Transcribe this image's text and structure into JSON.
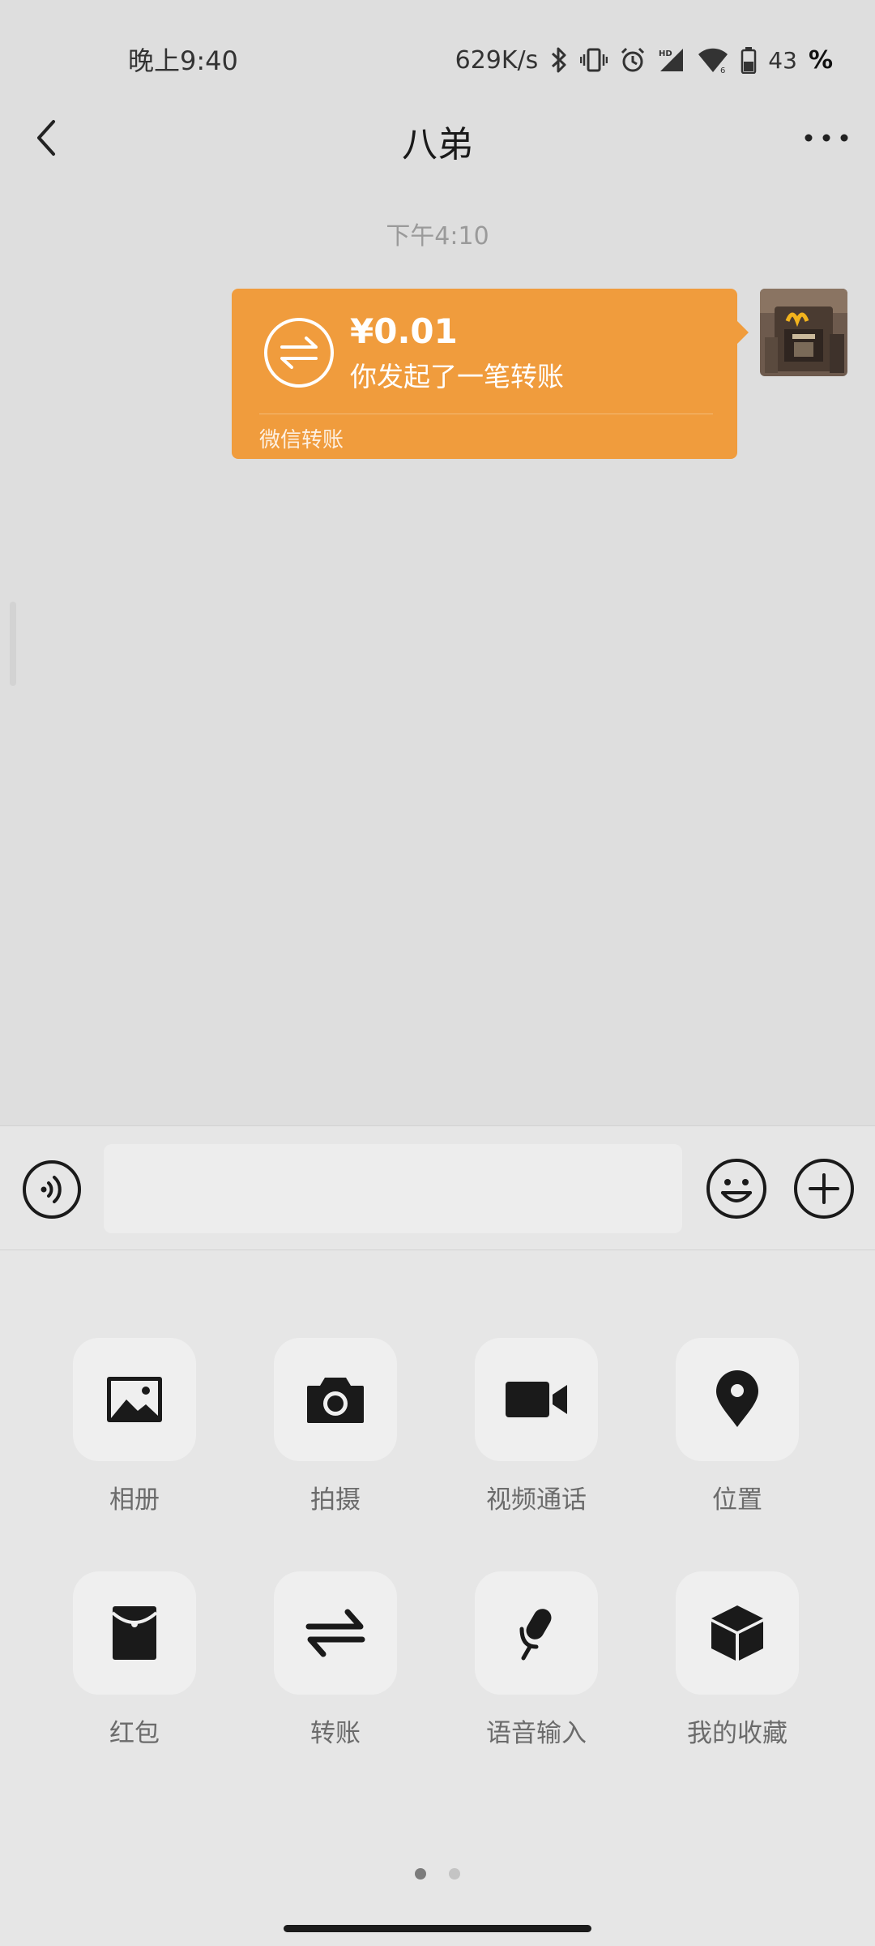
{
  "status_bar": {
    "time": "晚上9:40",
    "network_speed": "629K/s",
    "battery_level": "43",
    "battery_percent_sign": "%",
    "icons": [
      "bluetooth-icon",
      "vibrate-icon",
      "alarm-icon",
      "signal-icon",
      "wifi-icon",
      "battery-icon"
    ]
  },
  "header": {
    "title": "八弟",
    "back_icon": "chevron-left-icon",
    "more_icon": "more-dots-icon"
  },
  "messages": {
    "timestamp": "下午4:10",
    "transfer": {
      "amount": "¥0.01",
      "description": "你发起了一笔转账",
      "footer": "微信转账",
      "color": "#f09c3d",
      "icon": "transfer-icon"
    }
  },
  "input_bar": {
    "voice_icon": "voice-icon",
    "input_value": "",
    "emoji_icon": "emoji-icon",
    "plus_icon": "plus-icon"
  },
  "tools": [
    {
      "label": "相册",
      "icon": "album-icon"
    },
    {
      "label": "拍摄",
      "icon": "camera-icon"
    },
    {
      "label": "视频通话",
      "icon": "video-call-icon"
    },
    {
      "label": "位置",
      "icon": "location-icon"
    },
    {
      "label": "红包",
      "icon": "red-packet-icon"
    },
    {
      "label": "转账",
      "icon": "transfer-icon"
    },
    {
      "label": "语音输入",
      "icon": "microphone-icon"
    },
    {
      "label": "我的收藏",
      "icon": "favorites-icon"
    }
  ],
  "pager": {
    "current_page": 1,
    "total_pages": 2
  }
}
